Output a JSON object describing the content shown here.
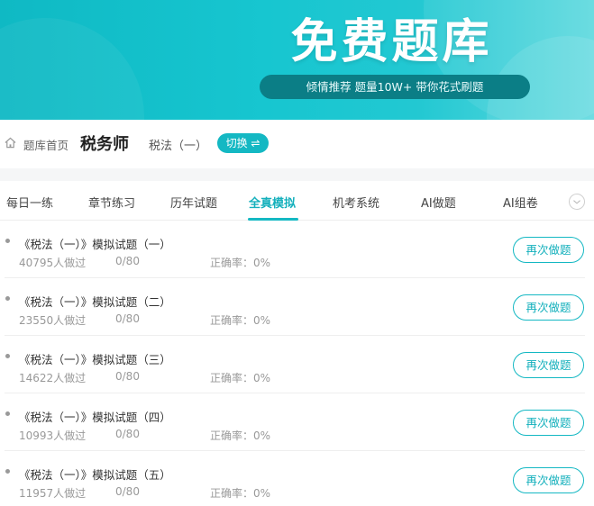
{
  "banner": {
    "title": "免费题库",
    "subtitle": "倾情推荐 题量10W+ 带你花式刷题"
  },
  "breadcrumb": {
    "home_label": "题库首页",
    "exam_name": "税务师",
    "subject_name": "税法（一）",
    "switch_label": "切换 ⇌"
  },
  "tabs": [
    {
      "label": "每日一练",
      "active": false
    },
    {
      "label": "章节练习",
      "active": false
    },
    {
      "label": "历年试题",
      "active": false
    },
    {
      "label": "全真模拟",
      "active": true
    },
    {
      "label": "机考系统",
      "active": false
    },
    {
      "label": "AI做题",
      "active": false
    },
    {
      "label": "AI组卷",
      "active": false
    }
  ],
  "papers": [
    {
      "title": "《税法（一）》模拟试题（一）",
      "count": "40795人做过",
      "progress": "0/80",
      "accuracy": "正确率：0%",
      "action": "再次做题"
    },
    {
      "title": "《税法（一）》模拟试题（二）",
      "count": "23550人做过",
      "progress": "0/80",
      "accuracy": "正确率：0%",
      "action": "再次做题"
    },
    {
      "title": "《税法（一）》模拟试题（三）",
      "count": "14622人做过",
      "progress": "0/80",
      "accuracy": "正确率：0%",
      "action": "再次做题"
    },
    {
      "title": "《税法（一）》模拟试题（四）",
      "count": "10993人做过",
      "progress": "0/80",
      "accuracy": "正确率：0%",
      "action": "再次做题"
    },
    {
      "title": "《税法（一）》模拟试题（五）",
      "count": "11957人做过",
      "progress": "0/80",
      "accuracy": "正确率：0%",
      "action": "再次做题"
    }
  ],
  "colors": {
    "accent": "#14b8c3",
    "accent_text": "#14b0bc",
    "pill": "#0b7e86"
  },
  "icons": {
    "home": "home-icon",
    "tabs_more": "chevron-down-icon"
  }
}
